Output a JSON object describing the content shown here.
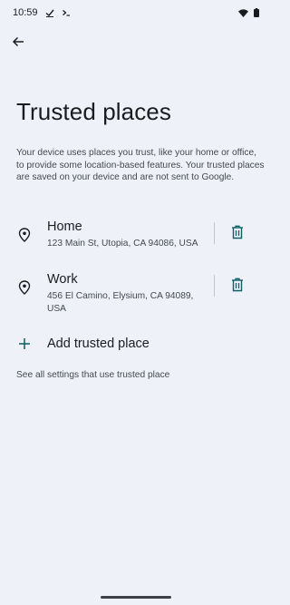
{
  "status_bar": {
    "time": "10:59",
    "icons": [
      "check-icon",
      "terminal-icon",
      "wifi-icon",
      "battery-icon"
    ]
  },
  "header": {
    "back_icon": "arrow-left-icon"
  },
  "page": {
    "title": "Trusted places",
    "description": "Your device uses places you trust, like your home or office, to provide some location-based features. Your trusted places are saved on your device and are not sent to Google."
  },
  "places": [
    {
      "name": "Home",
      "address": "123 Main St, Utopia, CA 94086, USA",
      "icon": "location-pin-icon",
      "action_icon": "trash-icon"
    },
    {
      "name": "Work",
      "address": "456 El Camino, Elysium, CA 94089, USA",
      "icon": "location-pin-icon",
      "action_icon": "trash-icon"
    }
  ],
  "add_place": {
    "label": "Add trusted place",
    "icon": "plus-icon"
  },
  "footer": {
    "see_all_label": "See all settings that use trusted place"
  },
  "colors": {
    "background": "#eef2f8",
    "accent": "#0f5d67",
    "text_primary": "#1b1c1f",
    "text_secondary": "#44474f"
  }
}
